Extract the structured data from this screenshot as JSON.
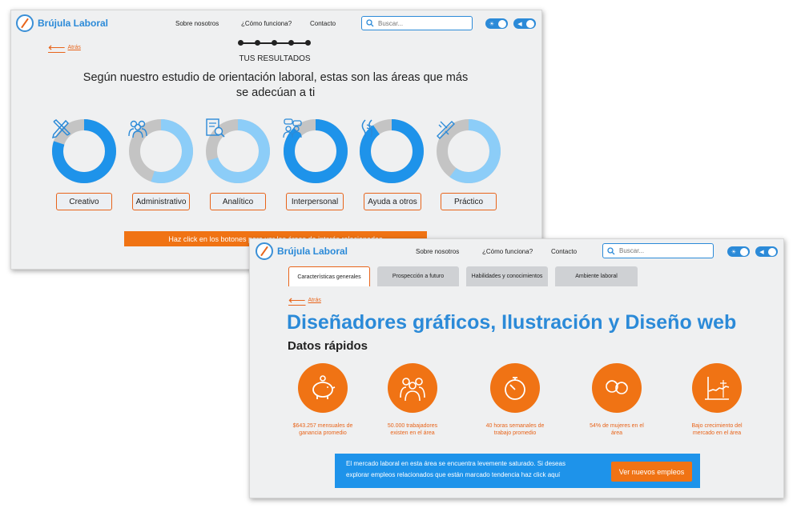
{
  "screen1": {
    "logo_text": "Brújula Laboral",
    "nav": [
      "Sobre nosotros",
      "¿Cómo funciona?",
      "Contacto"
    ],
    "search_placeholder": "Buscar...",
    "back_label": "Atrás",
    "steps_count": 5,
    "section_label": "TUS RESULTADOS",
    "headline_line1": "Según nuestro estudio de orientación laboral, estas son las áreas que más",
    "headline_line2": "se adecúan a ti",
    "areas": [
      {
        "label": "Creativo",
        "fill": 0.8,
        "style": "dark",
        "icon": "pencil-ruler-icon"
      },
      {
        "label": "Administrativo",
        "fill": 0.55,
        "style": "light",
        "icon": "people-group-icon"
      },
      {
        "label": "Analítico",
        "fill": 0.7,
        "style": "light",
        "icon": "document-analysis-icon"
      },
      {
        "label": "Interpersonal",
        "fill": 0.88,
        "style": "dark",
        "icon": "conversation-icon"
      },
      {
        "label": "Ayuda a otros",
        "fill": 0.9,
        "style": "dark",
        "icon": "helping-hands-icon"
      },
      {
        "label": "Práctico",
        "fill": 0.6,
        "style": "light",
        "icon": "caliper-tool-icon"
      }
    ],
    "banner_text": "Haz click en los botones para ver las áreas de interés relacionadas"
  },
  "screen2": {
    "logo_text": "Brújula Laboral",
    "nav": [
      "Sobre nosotros",
      "¿Cómo funciona?",
      "Contacto"
    ],
    "search_placeholder": "Buscar...",
    "tabs": [
      "Características generales",
      "Prospección a futuro",
      "Habilidades y conocimientos",
      "Ambiente laboral"
    ],
    "back_label": "Atrás",
    "title": "Diseñadores gráficos, Ilustración y Diseño web",
    "subtitle": "Datos rápidos",
    "facts": [
      {
        "icon": "piggy-bank-icon",
        "line1": "$643.257 mensuales de",
        "line2": "ganancia promedio"
      },
      {
        "icon": "people-crowd-icon",
        "line1": "50.000 trabajadores",
        "line2": "existen en el área"
      },
      {
        "icon": "stopwatch-icon",
        "line1": "40 horas semanales de",
        "line2": "trabajo promedio"
      },
      {
        "icon": "women-faces-icon",
        "line1": "54% de mujeres en el",
        "line2": "área"
      },
      {
        "icon": "growth-chart-icon",
        "line1": "Bajo crecimiento del",
        "line2": "mercado en el área"
      }
    ],
    "banner_line1": "El mercado laboral en esta área se encuentra levemente saturado. Si deseas",
    "banner_line2": "explorar empleos relacionados que están marcado tendencia haz click aquí",
    "banner_button": "Ver nuevos empleos"
  },
  "colors": {
    "brand_blue": "#2b8ad8",
    "accent_orange": "#f07314",
    "donut_dark": "#1e93ea",
    "donut_light": "#8ccdf8",
    "donut_track": "#c4c4c4"
  }
}
